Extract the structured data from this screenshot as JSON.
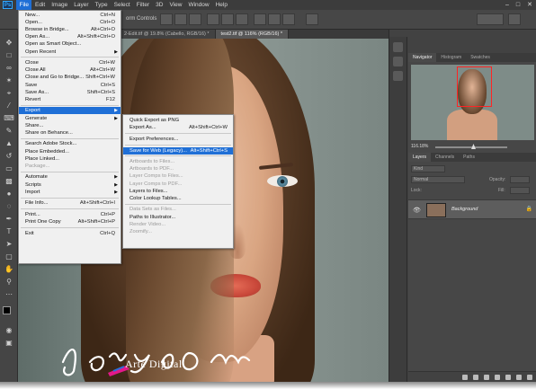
{
  "app": {
    "logo": "Ps",
    "accent": "#1f6fd6"
  },
  "menubar": [
    "File",
    "Edit",
    "Image",
    "Layer",
    "Type",
    "Select",
    "Filter",
    "3D",
    "View",
    "Window",
    "Help"
  ],
  "options_bar": {
    "transform_label": "orm Controls"
  },
  "tabs": [
    {
      "label": "2-Edit.tif @ 19.8% (Cabello, RGB/16) *",
      "active": false
    },
    {
      "label": "test2.tif @ 116% (RGB/16) *",
      "active": true
    }
  ],
  "file_menu": [
    {
      "label": "New...",
      "shortcut": "Ctrl+N"
    },
    {
      "label": "Open...",
      "shortcut": "Ctrl+O"
    },
    {
      "label": "Browse in Bridge...",
      "shortcut": "Alt+Ctrl+O"
    },
    {
      "label": "Open As...",
      "shortcut": "Alt+Shift+Ctrl+O"
    },
    {
      "label": "Open as Smart Object...",
      "shortcut": ""
    },
    {
      "label": "Open Recent",
      "shortcut": "",
      "submenu": true
    },
    {
      "sep": true
    },
    {
      "label": "Close",
      "shortcut": "Ctrl+W"
    },
    {
      "label": "Close All",
      "shortcut": "Alt+Ctrl+W"
    },
    {
      "label": "Close and Go to Bridge...",
      "shortcut": "Shift+Ctrl+W"
    },
    {
      "label": "Save",
      "shortcut": "Ctrl+S"
    },
    {
      "label": "Save As...",
      "shortcut": "Shift+Ctrl+S"
    },
    {
      "label": "Revert",
      "shortcut": "F12"
    },
    {
      "sep": true
    },
    {
      "label": "Export",
      "shortcut": "",
      "submenu": true,
      "highlighted": true
    },
    {
      "label": "Generate",
      "shortcut": "",
      "submenu": true
    },
    {
      "label": "Share...",
      "shortcut": ""
    },
    {
      "label": "Share on Behance...",
      "shortcut": ""
    },
    {
      "sep": true
    },
    {
      "label": "Search Adobe Stock...",
      "shortcut": ""
    },
    {
      "label": "Place Embedded...",
      "shortcut": ""
    },
    {
      "label": "Place Linked...",
      "shortcut": ""
    },
    {
      "label": "Package...",
      "shortcut": "",
      "disabled": true
    },
    {
      "sep": true
    },
    {
      "label": "Automate",
      "shortcut": "",
      "submenu": true
    },
    {
      "label": "Scripts",
      "shortcut": "",
      "submenu": true
    },
    {
      "label": "Import",
      "shortcut": "",
      "submenu": true
    },
    {
      "sep": true
    },
    {
      "label": "File Info...",
      "shortcut": "Alt+Shift+Ctrl+I"
    },
    {
      "sep": true
    },
    {
      "label": "Print...",
      "shortcut": "Ctrl+P"
    },
    {
      "label": "Print One Copy",
      "shortcut": "Alt+Shift+Ctrl+P"
    },
    {
      "sep": true
    },
    {
      "label": "Exit",
      "shortcut": "Ctrl+Q"
    }
  ],
  "export_menu": [
    {
      "label": "Quick Export as PNG",
      "shortcut": ""
    },
    {
      "label": "Export As...",
      "shortcut": "Alt+Shift+Ctrl+W"
    },
    {
      "sep": true
    },
    {
      "label": "Export Preferences...",
      "shortcut": ""
    },
    {
      "sep": true
    },
    {
      "label": "Save for Web (Legacy)...",
      "shortcut": "Alt+Shift+Ctrl+S",
      "highlighted": true
    },
    {
      "sep": true
    },
    {
      "label": "Artboards to Files...",
      "shortcut": "",
      "disabled": true
    },
    {
      "label": "Artboards to PDF...",
      "shortcut": "",
      "disabled": true
    },
    {
      "label": "Layer Comps to Files...",
      "shortcut": "",
      "disabled": true
    },
    {
      "label": "Layer Comps to PDF...",
      "shortcut": "",
      "disabled": true
    },
    {
      "label": "Layers to Files...",
      "shortcut": ""
    },
    {
      "label": "Color Lookup Tables...",
      "shortcut": ""
    },
    {
      "sep": true
    },
    {
      "label": "Data Sets as Files...",
      "shortcut": "",
      "disabled": true
    },
    {
      "label": "Paths to Illustrator...",
      "shortcut": ""
    },
    {
      "label": "Render Video...",
      "shortcut": "",
      "disabled": true
    },
    {
      "label": "Zoomify...",
      "shortcut": "",
      "disabled": true
    }
  ],
  "navigator": {
    "tabs": [
      "Navigator",
      "Histogram",
      "Swatches"
    ],
    "zoom": "116.18%"
  },
  "layers_panel": {
    "tabs": [
      "Layers",
      "Channels",
      "Paths"
    ],
    "kind": "Kind",
    "mode": "Normal",
    "opacity_label": "Opacity:",
    "fill_label": "Fill:",
    "lock_label": "Lock:",
    "layer_name": "Background"
  },
  "watermark": {
    "signature": "jorge ojeda",
    "brand": "Arte Digital"
  }
}
